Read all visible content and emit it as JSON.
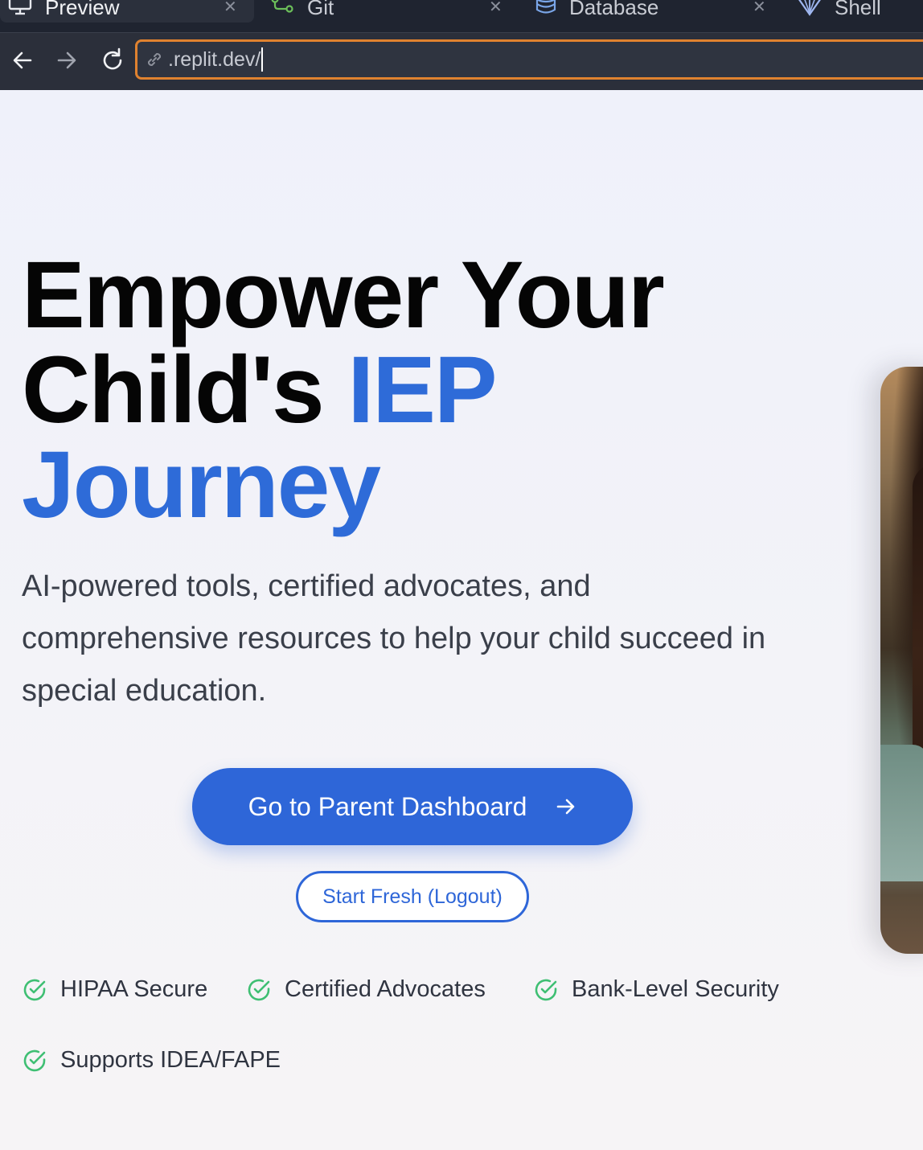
{
  "ide": {
    "tabs": [
      {
        "label": "Preview",
        "icon": "monitor-icon",
        "active": true
      },
      {
        "label": "Git",
        "icon": "git-branch-icon",
        "active": false
      },
      {
        "label": "Database",
        "icon": "database-icon",
        "active": false
      },
      {
        "label": "Shell",
        "icon": "shell-icon",
        "active": false
      }
    ],
    "address_bar": {
      "url": ".replit.dev/"
    }
  },
  "hero": {
    "title_line1": "Empower Your",
    "title_line2_plain": "Child's ",
    "title_line2_accent": "IEP",
    "title_line3_accent": "Journey",
    "subtitle": "AI-powered tools, certified advocates, and comprehensive resources to help your child succeed in special education.",
    "primary_cta": "Go to Parent Dashboard",
    "secondary_cta": "Start Fresh (Logout)",
    "badges": [
      "HIPAA Secure",
      "Certified Advocates",
      "Bank-Level Security",
      "Supports IDEA/FAPE"
    ]
  },
  "colors": {
    "accent": "#2e6bd8",
    "badge_check": "#3fbf73",
    "url_focus_border": "#e0822f",
    "ide_background": "#1f2430"
  }
}
